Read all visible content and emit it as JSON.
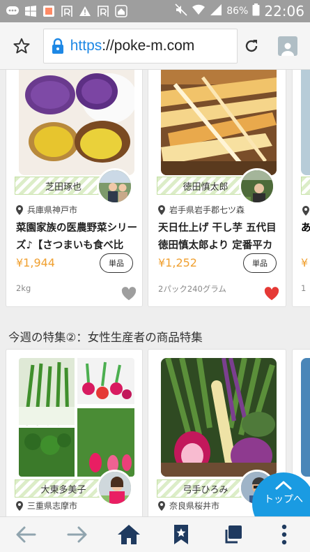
{
  "status_bar": {
    "battery": "86%",
    "time": "22:06"
  },
  "browser": {
    "url_scheme": "https",
    "url_rest": "://poke-m.com"
  },
  "products_row1": [
    {
      "producer": "芝田琢也",
      "location": "兵庫県神戸市",
      "title": "菜園家族の医農野菜シリーズ♪【さつまいも食べ比",
      "price": "¥1,944",
      "unit_label": "単品",
      "quantity": "2kg",
      "favorited": false
    },
    {
      "producer": "徳田慎太郎",
      "location": "岩手県岩手郡七ツ森",
      "title": "天日仕上げ 干し芋 五代目徳田慎太郎より 定番平カ",
      "price": "¥1,252",
      "unit_label": "単品",
      "quantity": "2パック240グラム",
      "favorited": true
    }
  ],
  "partial_card": {
    "title_start": "あ",
    "price_start": "¥",
    "qty_start": "1"
  },
  "section": {
    "title": "今週の特集②：女性生産者の商品特集"
  },
  "products_row2": [
    {
      "producer": "大東多美子",
      "location": "三重県志摩市"
    },
    {
      "producer": "弓手ひろみ",
      "location": "奈良県桜井市"
    }
  ],
  "top_button": {
    "label": "トップへ"
  },
  "colors": {
    "price": "#f0a030",
    "accent": "#1a9be2",
    "heart_active": "#e53935",
    "heart_inactive": "#9e9e9e"
  }
}
